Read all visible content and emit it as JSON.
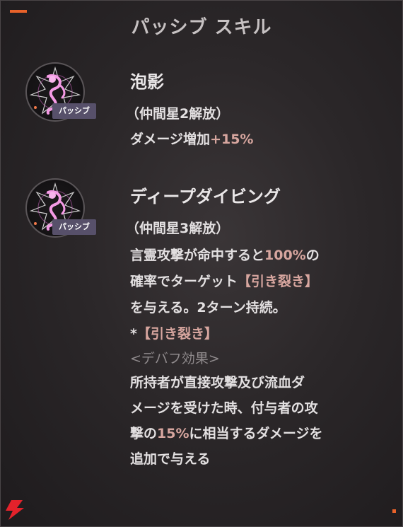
{
  "header": {
    "title": "パッシブ スキル"
  },
  "skills": [
    {
      "name": "泡影",
      "badge": "パッシブ",
      "icon": "mermaid-character-icon",
      "unlock": "（仲間星2解放）",
      "effect_prefix": "ダメージ増加",
      "effect_value": "+15%"
    },
    {
      "name": "ディープダイビング",
      "badge": "パッシブ",
      "icon": "mermaid-character-icon",
      "unlock": "（仲間星3解放）",
      "l1_a": "言霊攻撃が命中すると",
      "l1_b": "100%",
      "l1_c": "の",
      "l2_a": "確率でターゲット",
      "l2_b": "【引き裂き】",
      "l3": "を与える。2ターン持続。",
      "l4_a": "*",
      "l4_b": "【引き裂き】",
      "l5": "<デバフ効果>",
      "l6": "所持者が直接攻撃及び流血ダ",
      "l7": "メージを受けた時、付与者の攻",
      "l8_a": "撃の",
      "l8_b": "15%",
      "l8_c": "に相当するダメージを",
      "l9": "追加で与える"
    }
  ],
  "colors": {
    "accent": "#e8622a",
    "highlight": "#d7a69f",
    "badge_bg": "#57506a"
  }
}
